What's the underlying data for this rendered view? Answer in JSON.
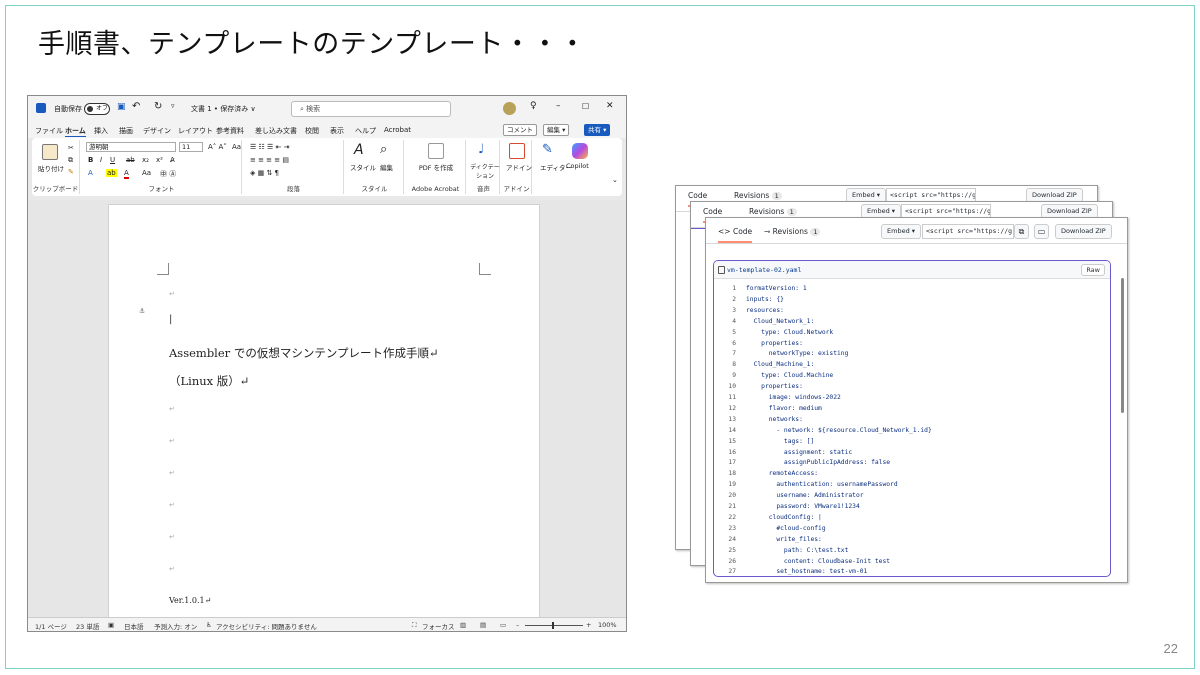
{
  "slide": {
    "title": "手順書、テンプレートのテンプレート・・・",
    "page_number": "22"
  },
  "word": {
    "autosave_label": "自動保存",
    "autosave_state": "オフ",
    "doc_title": "文書 1 • 保存済み ∨",
    "search_placeholder": "検索",
    "menu": [
      "ファイル",
      "ホーム",
      "挿入",
      "描画",
      "デザイン",
      "レイアウト",
      "参考資料",
      "差し込み文書",
      "校閲",
      "表示",
      "ヘルプ",
      "Acrobat"
    ],
    "comment_btn": "コメント",
    "edit_btn": "編集 ▾",
    "share_btn": "共有 ▾",
    "font_name": "游明朝",
    "font_size": "11",
    "ribbon_groups": [
      "クリップボード",
      "フォント",
      "段落",
      "スタイル",
      "Adobe Acrobat",
      "音声",
      "アドイン"
    ],
    "ribbon_buttons": {
      "paste": "貼り付け",
      "styles": "スタイル",
      "edit": "編集",
      "pdf": "PDF を作成",
      "dictate": "ディクテーション",
      "addins": "アドイン",
      "editor": "エディター",
      "copilot": "Copilot"
    },
    "doc_lines": [
      "Assembler での仮想マシンテンプレート作成手順↵",
      "（Linux 版）↵"
    ],
    "version": "Ver.1.0.1↵",
    "para_mark": "↵",
    "status": {
      "page": "1/1 ページ",
      "words": "23 単語",
      "lang": "日本語",
      "predict": "予測入力: オン",
      "access": "アクセシビリティ: 問題ありません",
      "focus": "フォーカス",
      "zoom": "100%"
    }
  },
  "gist": {
    "tab_code": "Code",
    "tab_revisions": "Revisions",
    "revisions_count": "1",
    "embed": "Embed ▾",
    "embed_value": "<script src=\"https://g",
    "download": "Download ZIP",
    "filename": "vm-template-02.yaml",
    "raw": "Raw",
    "code": [
      "formatVersion: 1",
      "inputs: {}",
      "resources:",
      "  Cloud_Network_1:",
      "    type: Cloud.Network",
      "    properties:",
      "      networkType: existing",
      "  Cloud_Machine_1:",
      "    type: Cloud.Machine",
      "    properties:",
      "      image: windows-2022",
      "      flavor: medium",
      "      networks:",
      "        - network: ${resource.Cloud_Network_1.id}",
      "          tags: []",
      "          assignment: static",
      "          assignPublicIpAddress: false",
      "      remoteAccess:",
      "        authentication: usernamePassword",
      "        username: Administrator",
      "        password: VMware1!1234",
      "      cloudConfig: |",
      "        #cloud-config",
      "        write_files:",
      "          path: C:\\test.txt",
      "          content: Cloudbase-Init test",
      "        set_hostname: test-vm-01"
    ]
  }
}
